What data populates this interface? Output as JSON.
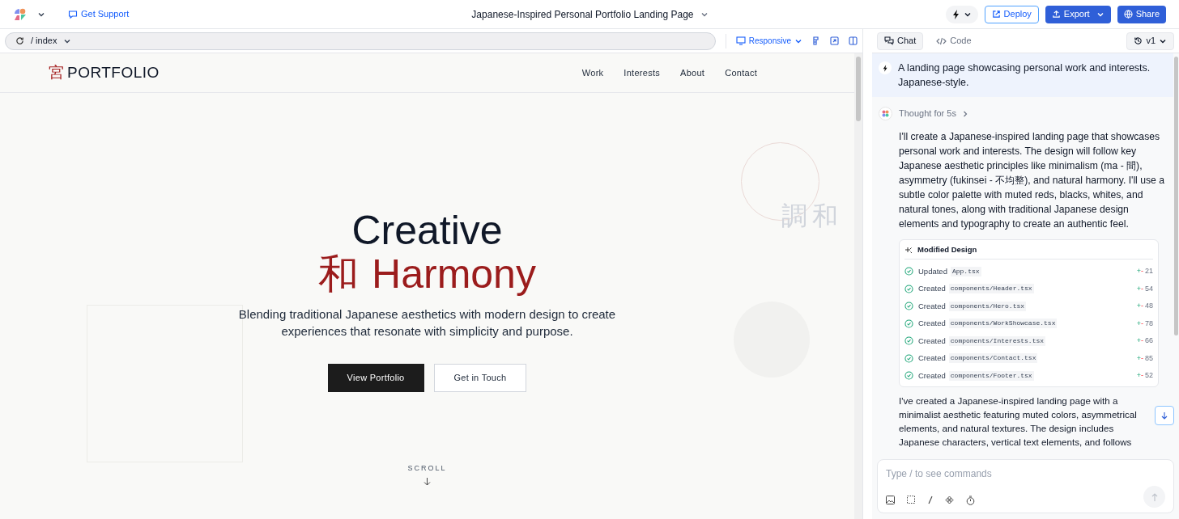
{
  "top_bar": {
    "support": "Get Support",
    "title": "Japanese-Inspired Personal Portfolio Landing Page",
    "actions": [
      {
        "label": "Deploy",
        "kind": "outline"
      },
      {
        "label": "Export",
        "kind": "dropdown"
      },
      {
        "label": "Share",
        "kind": "solid"
      }
    ]
  },
  "preview_bar": {
    "path": "/ index",
    "viewport": "Responsive"
  },
  "chat_tabs": [
    {
      "label": "Chat",
      "selected": true
    },
    {
      "label": "Code",
      "selected": false
    }
  ],
  "version": "v1",
  "site": {
    "logo_mark": "宮",
    "logo": "PORTFOLIO",
    "nav": [
      "Work",
      "Interests",
      "About",
      "Contact"
    ],
    "deco_text": "調和",
    "title": "Creative",
    "title_mark": "和",
    "title_accent": "Harmony",
    "subtitle": "Blending traditional Japanese aesthetics with modern design to create experiences that resonate with simplicity and purpose.",
    "buttons": [
      {
        "label": "View Portfolio",
        "kind": "primary"
      },
      {
        "label": "Get in Touch",
        "kind": "secondary"
      }
    ],
    "scroll": "SCROLL"
  },
  "chat": {
    "prompt": "A landing page showcasing personal work and interests. Japanese-style.",
    "thought": "Thought for 5s",
    "reply": "I'll create a Japanese-inspired landing page that showcases personal work and interests. The design will follow key Japanese aesthetic principles like minimalism (ma - 間), asymmetry (fukinsei - 不均整), and natural harmony. I'll use a subtle color palette with muted reds, blacks, whites, and natural tones, along with traditional Japanese design elements and typography to create an authentic feel.",
    "changes_title": "Modified Design",
    "files": [
      {
        "action": "Updated",
        "file": "App.tsx",
        "plus": "+",
        "minus": "-",
        "count": "21"
      },
      {
        "action": "Created",
        "file": "components/Header.tsx",
        "plus": "+",
        "minus": "-",
        "count": "54"
      },
      {
        "action": "Created",
        "file": "components/Hero.tsx",
        "plus": "+",
        "minus": "-",
        "count": "48"
      },
      {
        "action": "Created",
        "file": "components/WorkShowcase.tsx",
        "plus": "+",
        "minus": "-",
        "count": "78"
      },
      {
        "action": "Created",
        "file": "components/Interests.tsx",
        "plus": "+",
        "minus": "-",
        "count": "66"
      },
      {
        "action": "Created",
        "file": "components/Contact.tsx",
        "plus": "+",
        "minus": "-",
        "count": "85"
      },
      {
        "action": "Created",
        "file": "components/Footer.tsx",
        "plus": "+",
        "minus": "-",
        "count": "52"
      }
    ],
    "summary": "I've created a Japanese-inspired landing page with a minimalist aesthetic featuring muted colors, asymmetrical elements, and natural textures. The design includes Japanese characters, vertical text elements, and follows",
    "input_placeholder": "Type / to see commands"
  }
}
